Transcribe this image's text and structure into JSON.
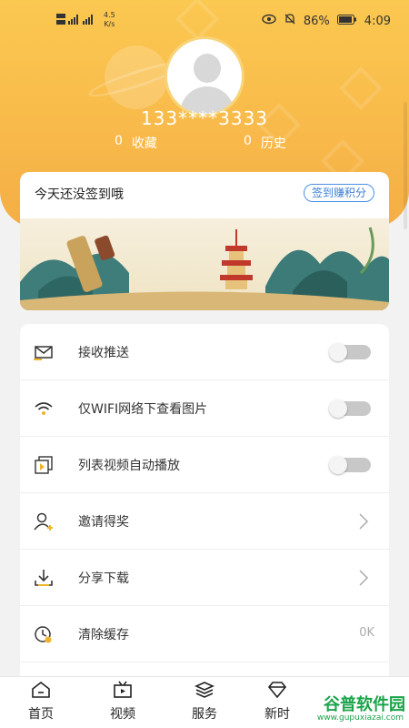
{
  "status_bar": {
    "net_speed_value": "4.5",
    "net_speed_unit": "K/s",
    "battery": "86%",
    "time": "4:09"
  },
  "profile": {
    "phone": "133****3333",
    "favorites_count": "0",
    "favorites_label": "收藏",
    "history_count": "0",
    "history_label": "历史"
  },
  "signin": {
    "title": "今天还没签到哦",
    "button": "签到赚积分"
  },
  "settings": {
    "items": [
      {
        "label": "接收推送",
        "icon": "message-icon",
        "control": "toggle",
        "on": false
      },
      {
        "label": "仅WIFI网络下查看图片",
        "icon": "wifi-icon",
        "control": "toggle",
        "on": false
      },
      {
        "label": "列表视频自动播放",
        "icon": "video-play-icon",
        "control": "toggle",
        "on": false
      },
      {
        "label": "邀请得奖",
        "icon": "invite-user-icon",
        "control": "chevron"
      },
      {
        "label": "分享下载",
        "icon": "download-icon",
        "control": "chevron"
      },
      {
        "label": "清除缓存",
        "icon": "clear-cache-icon",
        "control": "value",
        "value": "0K"
      }
    ]
  },
  "tabbar": {
    "tabs": [
      {
        "label": "首页",
        "icon": "home-icon"
      },
      {
        "label": "视频",
        "icon": "video-icon"
      },
      {
        "label": "服务",
        "icon": "layers-icon"
      },
      {
        "label": "新时",
        "icon": "diamond-icon"
      }
    ]
  },
  "watermark": {
    "text": "谷普软件园",
    "url": "www.gupuxiazai.com"
  },
  "colors": {
    "header": "#f8b94a",
    "accent_blue": "#3b7fd4",
    "watermark_green": "#1aa34a"
  }
}
